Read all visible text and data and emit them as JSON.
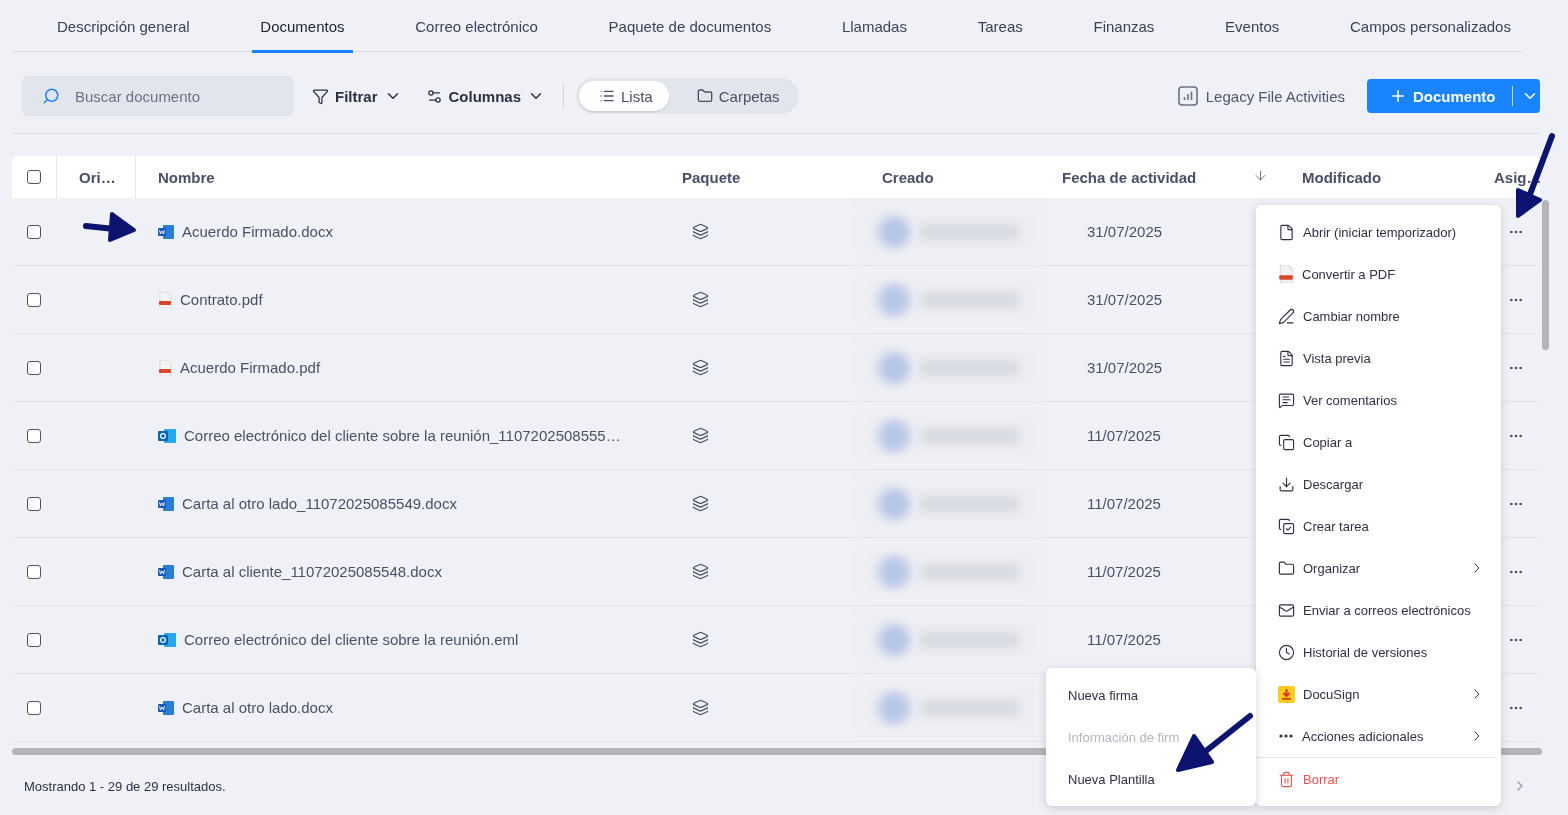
{
  "tabs": [
    {
      "label": "Descripción general",
      "selected": false
    },
    {
      "label": "Documentos",
      "selected": true
    },
    {
      "label": "Correo electrónico",
      "selected": false
    },
    {
      "label": "Paquete de documentos",
      "selected": false
    },
    {
      "label": "Llamadas",
      "selected": false
    },
    {
      "label": "Tareas",
      "selected": false
    },
    {
      "label": "Finanzas",
      "selected": false
    },
    {
      "label": "Eventos",
      "selected": false
    },
    {
      "label": "Campos personalizados",
      "selected": false
    }
  ],
  "search": {
    "placeholder": "Buscar documento"
  },
  "toolbar": {
    "filter": "Filtrar",
    "columns": "Columnas",
    "views": [
      {
        "label": "Lista",
        "selected": true
      },
      {
        "label": "Carpetas",
        "selected": false
      }
    ],
    "legacy": "Legacy File Activities",
    "new_button": "Documento"
  },
  "table": {
    "select_all": {
      "checked": false
    },
    "columns": [
      {
        "label": "Ori…",
        "sorted": false
      },
      {
        "label": "Nombre",
        "sorted": false
      },
      {
        "label": "Paquete",
        "sorted": false
      },
      {
        "label": "Creado",
        "sorted": false
      },
      {
        "label": "Fecha de actividad",
        "sorted": true
      },
      {
        "label": "Modificado",
        "sorted": false
      },
      {
        "label": "Asig…",
        "sorted": false
      }
    ],
    "rows": [
      {
        "checked": false,
        "kind": "word",
        "name": "Acuerdo Firmado.docx",
        "date": "31/07/2025"
      },
      {
        "checked": false,
        "kind": "pdf",
        "name": "Contrato.pdf",
        "date": "31/07/2025"
      },
      {
        "checked": false,
        "kind": "pdf",
        "name": "Acuerdo Firmado.pdf",
        "date": "31/07/2025"
      },
      {
        "checked": false,
        "kind": "outlook",
        "name": "Correo electrónico del cliente sobre la reunión_1107202508555…",
        "date": "11/07/2025"
      },
      {
        "checked": false,
        "kind": "word",
        "name": "Carta al otro lado_11072025085549.docx",
        "date": "11/07/2025"
      },
      {
        "checked": false,
        "kind": "word",
        "name": "Carta al cliente_11072025085548.docx",
        "date": "11/07/2025"
      },
      {
        "checked": false,
        "kind": "outlook",
        "name": "Correo electrónico del cliente sobre la reunión.eml",
        "date": "11/07/2025"
      },
      {
        "checked": false,
        "kind": "word",
        "name": "Carta al otro lado.docx"
      }
    ]
  },
  "footer": "Mostrando 1 - 29 de 29 resultados.",
  "context_menu": {
    "items": [
      {
        "label": "Abrir (iniciar temporizador)",
        "kind": "action",
        "has_submenu": false
      },
      {
        "label": "Convertir a PDF",
        "kind": "action",
        "has_submenu": false
      },
      {
        "label": "Cambiar nombre",
        "kind": "action",
        "has_submenu": false
      },
      {
        "label": "Vista previa",
        "kind": "action",
        "has_submenu": false
      },
      {
        "label": "Ver comentarios",
        "kind": "action",
        "has_submenu": false
      },
      {
        "label": "Copiar a",
        "kind": "action",
        "has_submenu": false
      },
      {
        "label": "Descargar",
        "kind": "action",
        "has_submenu": false
      },
      {
        "label": "Crear tarea",
        "kind": "action",
        "has_submenu": false
      },
      {
        "label": "Organizar",
        "kind": "action",
        "has_submenu": true
      },
      {
        "label": "Enviar a correos electrónicos",
        "kind": "action",
        "has_submenu": false
      },
      {
        "label": "Historial de versiones",
        "kind": "action",
        "has_submenu": false
      },
      {
        "label": "DocuSign",
        "kind": "action",
        "has_submenu": true
      },
      {
        "label": "Acciones adicionales",
        "kind": "action",
        "has_submenu": true
      },
      {
        "label": "Borrar",
        "kind": "danger",
        "has_submenu": false
      }
    ]
  },
  "submenu": {
    "items": [
      {
        "label": "Nueva firma",
        "disabled": false
      },
      {
        "label": "Información de firm",
        "disabled": true
      },
      {
        "label": "Nueva Plantilla",
        "disabled": false
      }
    ]
  }
}
